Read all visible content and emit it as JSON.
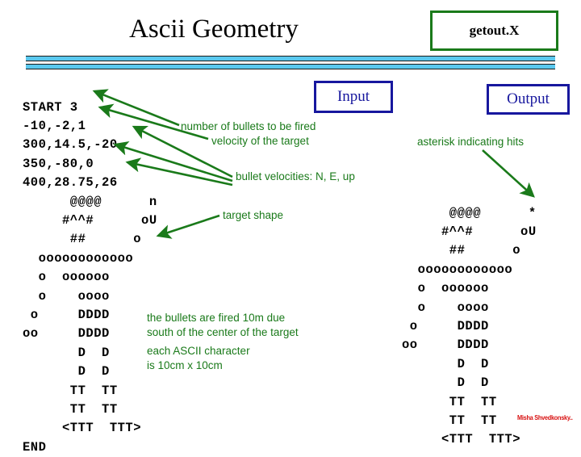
{
  "slide": {
    "title": "Ascii Geometry",
    "file_label": "getout.X",
    "watermark": "Misha Shvedkonsky.."
  },
  "sections": {
    "input_label": "Input",
    "output_label": "Output"
  },
  "input_listing": "START 3\n-10,-2,1\n300,14.5,-20\n350,-80,0\n400,28.75,26\n      @@@@      n\n     #^^#      oU\n      ##      o\n  oooooooooooo\n  o  oooooo\n  o    oooo\n o     DDDD\noo     DDDD\n       D  D\n       D  D\n      TT  TT\n      TT  TT\n     <TTT  TTT>\nEND",
  "output_listing": "      @@@@      *\n     #^^#      oU\n      ##      o\n  oooooooooooo\n  o  oooooo\n  o    oooo\n o     DDDD\noo     DDDD\n       D  D\n       D  D\n      TT  TT\n      TT  TT\n     <TTT  TTT>",
  "annotations": {
    "bullets_count": "number of bullets to be fired",
    "target_velocity": "velocity of the target",
    "bullet_velocities": "bullet velocities: N, E, up",
    "target_shape": "target shape",
    "asterisk_hits": "asterisk indicating hits",
    "fired_note": "the bullets are fired 10m due\nsouth of the center of the target",
    "char_size_note": "each ASCII character\nis 10cm x 10cm"
  },
  "colors": {
    "accent_green": "#1a7a1a",
    "label_navy": "#17179e",
    "divider_cyan": "#5ac8ee",
    "watermark_red": "#d81111"
  }
}
